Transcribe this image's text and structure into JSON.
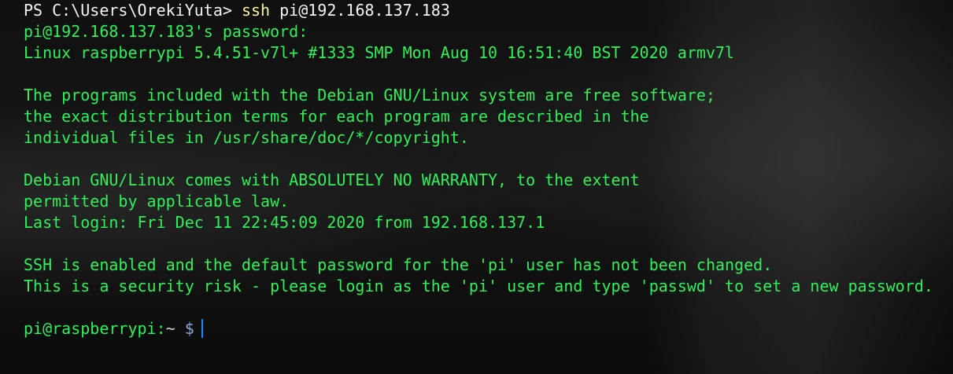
{
  "ps": {
    "prompt": "PS C:\\Users\\OrekiYuta>",
    "command": "ssh",
    "argument": "pi@192.168.137.183"
  },
  "output": {
    "password_line": "pi@192.168.137.183's password:",
    "uname_line": "Linux raspberrypi 5.4.51-v7l+ #1333 SMP Mon Aug 10 16:51:40 BST 2020 armv7l",
    "license_lines": [
      "The programs included with the Debian GNU/Linux system are free software;",
      "the exact distribution terms for each program are described in the",
      "individual files in /usr/share/doc/*/copyright."
    ],
    "warranty_lines": [
      "Debian GNU/Linux comes with ABSOLUTELY NO WARRANTY, to the extent",
      "permitted by applicable law."
    ],
    "last_login": "Last login: Fri Dec 11 22:45:09 2020 from 192.168.137.1",
    "security_lines": [
      "SSH is enabled and the default password for the 'pi' user has not been changed.",
      "This is a security risk - please login as the 'pi' user and type 'passwd' to set a new password."
    ]
  },
  "shell_prompt": {
    "user_host": "pi@raspberrypi",
    "separator": ":",
    "directory": "~",
    "symbol": "$"
  },
  "colors": {
    "output_green": "#2ff05a",
    "command_yellow": "#f9f1a5",
    "cursor_blue": "#2b87f2",
    "background": "#0c0c0c"
  }
}
